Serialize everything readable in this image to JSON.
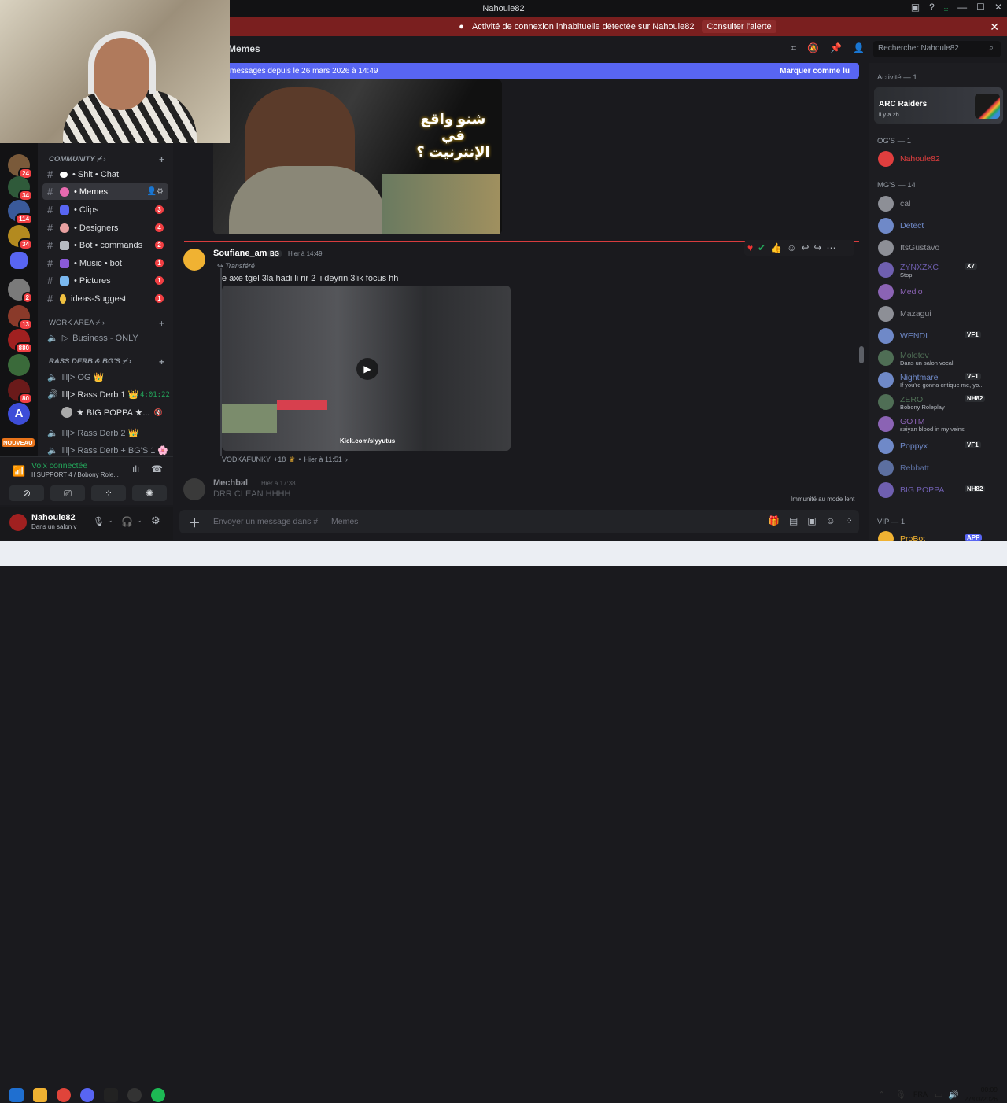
{
  "window": {
    "title": "Nahoule82"
  },
  "alert": {
    "text": "Activité de connexion inhabituelle détectée sur Nahoule82",
    "button": "Consulter l'alerte"
  },
  "header": {
    "channel": "Memes",
    "search_placeholder": "Rechercher Nahoule82"
  },
  "new_messages": {
    "text": "messages depuis le 26 mars 2026 à 14:49",
    "mark_read": "Marquer comme lu"
  },
  "servers": {
    "badges": [
      "24",
      "34",
      "114",
      "34",
      "2",
      "13",
      "880",
      "80"
    ],
    "new_label": "NOUVEAU"
  },
  "channels": {
    "categories": [
      {
        "name": "COMMUNITY ⌿ ›"
      },
      {
        "name": "WORK AREA ⌿ ›"
      },
      {
        "name": "RASS DERB & BG'S ⌿ ›"
      }
    ],
    "items": [
      {
        "label": "• Shit • Chat",
        "badge": ""
      },
      {
        "label": "• Memes",
        "badge": ""
      },
      {
        "label": "• Clips",
        "badge": "3"
      },
      {
        "label": "• Designers",
        "badge": "4"
      },
      {
        "label": "• Bot • commands",
        "badge": "2"
      },
      {
        "label": "• Music • bot",
        "badge": "1"
      },
      {
        "label": "• Pictures",
        "badge": "1"
      },
      {
        "label": "ideas-Suggest",
        "badge": "1"
      }
    ],
    "business": "Business - ONLY",
    "voice": [
      {
        "label": "lll|> OG 👑"
      },
      {
        "label": "lll|> Rass Derb 1 👑",
        "time": "4:01:22"
      },
      {
        "label": "★ BIG POPPA ★..."
      },
      {
        "label": "lll|> Rass Derb 2 👑"
      },
      {
        "label": "lll|> Rass Derb + BG'S 1 🌸"
      }
    ]
  },
  "voice_panel": {
    "status": "Voix connectée",
    "channel": "II SUPPORT 4 / Bobony Role..."
  },
  "user_panel": {
    "name": "Nahoule82",
    "status": "Dans un salon v"
  },
  "messages": [
    {
      "author": "Soufiane_am",
      "tag": "BG",
      "time": "Hier à 14:49",
      "forwarded": "Transféré",
      "text": "e axe tgel 3la hadi li rir 2 li deyrin 3lik focus hh",
      "video_caption": "Kick.com/slyyutus",
      "footer_user": "VODKAFUNKY",
      "footer_extra": "+18",
      "footer_time": "Hier à 11:51"
    },
    {
      "author": "Mechbal",
      "time": "Hier à 17:38",
      "text": "DRR CLEAN HHHH"
    }
  ],
  "meme_text": "شنو واقع في الإنترنيت ؟",
  "slowmode": "Immunité au mode lent",
  "composer": {
    "placeholder": "Envoyer un message dans #",
    "channel": "Memes"
  },
  "members": {
    "activity_header": "Activité — 1",
    "activity": {
      "game": "ARC Raiders",
      "ago": "il y a 2h",
      "logo": "ARC Raiders"
    },
    "groups": [
      {
        "header": "OG'S — 1"
      },
      {
        "header": "MG'S — 14"
      },
      {
        "header": "VIP — 1"
      }
    ],
    "list": [
      {
        "name": "Nahoule82",
        "status": "",
        "tag": "",
        "color": "#e03e3e"
      },
      {
        "name": "cal",
        "status": "",
        "tag": "",
        "color": "#8d8f96"
      },
      {
        "name": "Detect",
        "status": "",
        "tag": "",
        "color": "#6f89c8"
      },
      {
        "name": "ItsGustavo",
        "status": "",
        "tag": "",
        "color": "#8d8f96"
      },
      {
        "name": "ZYNXZXC",
        "status": "Stop",
        "tag": "X7",
        "color": "#6f5fb0"
      },
      {
        "name": "Medio",
        "status": "",
        "tag": "",
        "color": "#8b63b4"
      },
      {
        "name": "Mazagui",
        "status": "",
        "tag": "",
        "color": "#8d8f96"
      },
      {
        "name": "WENDI",
        "status": "",
        "tag": "VF1",
        "color": "#6f89c8"
      },
      {
        "name": "Molotov",
        "status": "Dans un salon vocal",
        "tag": "",
        "color": "#4f6e55"
      },
      {
        "name": "Nightmare",
        "status": "If you're gonna critique me, yo...",
        "tag": "VF1",
        "color": "#6f89c8"
      },
      {
        "name": "ZERO",
        "status": "Bobony Roleplay",
        "tag": "NH82",
        "color": "#4f6e55"
      },
      {
        "name": "GOTM",
        "status": "saiyan blood in my veins",
        "tag": "",
        "color": "#8b63b4"
      },
      {
        "name": "Poppyx",
        "status": "",
        "tag": "VF1",
        "color": "#6f89c8"
      },
      {
        "name": "Rebbatt",
        "status": "",
        "tag": "",
        "color": "#5c6fa0"
      },
      {
        "name": "BIG POPPA",
        "status": "",
        "tag": "NH82",
        "color": "#6f5fb0"
      },
      {
        "name": "ProBot",
        "status": "",
        "tag": "APP",
        "color": "#f0b232"
      }
    ]
  },
  "taskbar": {
    "lang": "FRA",
    "time": "00:09",
    "date": "27/03/2026"
  }
}
